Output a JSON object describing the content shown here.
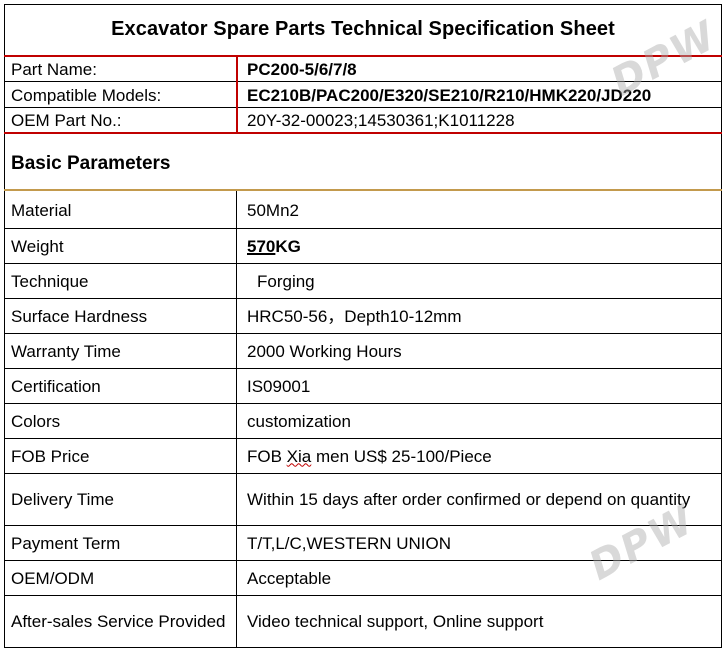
{
  "title": "Excavator Spare Parts Technical Specification Sheet",
  "header_rows": [
    {
      "label": "Part Name:",
      "value": "PC200-5/6/7/8"
    },
    {
      "label": "Compatible Models:",
      "value": "EC210B/PAC200/E320/SE210/R210/HMK220/JD220"
    },
    {
      "label": "OEM Part No.:",
      "value": "20Y-32-00023;14530361;K1011228"
    }
  ],
  "section_title": "Basic Parameters",
  "params": {
    "material": {
      "label": "Material",
      "value": "50Mn2"
    },
    "weight": {
      "label": "Weight",
      "value_num": "570",
      "value_unit": "KG"
    },
    "technique": {
      "label": "Technique",
      "value": "Forging"
    },
    "hardness": {
      "label": "Surface Hardness",
      "value": "HRC50-56，Depth10-12mm"
    },
    "warranty": {
      "label": "Warranty Time",
      "value": "2000 Working Hours"
    },
    "certification": {
      "label": "Certification",
      "value": "IS09001"
    },
    "colors": {
      "label": "Colors",
      "value": "customization"
    },
    "fob": {
      "label": "FOB Price",
      "value_pre": "FOB ",
      "value_mark": "Xia",
      "value_post": " men US$ 25-100/Piece"
    },
    "delivery": {
      "label": "Delivery Time",
      "value": "Within 15 days after order confirmed or depend on quantity"
    },
    "payment": {
      "label": "Payment Term",
      "value": "T/T,L/C,WESTERN UNION"
    },
    "oem": {
      "label": "OEM/ODM",
      "value": "Acceptable"
    },
    "aftersales": {
      "label": "After-sales Service Provided",
      "value": "Video technical support, Online support"
    }
  },
  "watermark": "DPW"
}
